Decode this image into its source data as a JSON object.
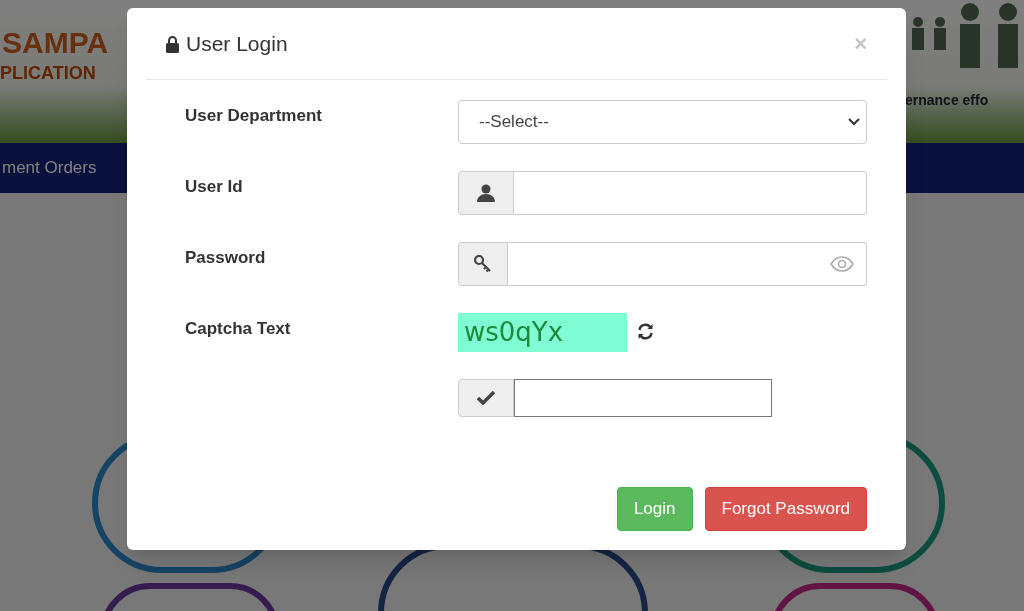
{
  "background": {
    "logo_text": "SAMPA",
    "logo_subtitle": "PLICATION",
    "tagline": "ernance effo",
    "nav_item": "ment Orders"
  },
  "modal": {
    "title": "User Login",
    "close": "×",
    "fields": [
      {
        "kind": "select",
        "label": "User Department",
        "value": "--Select--"
      },
      {
        "kind": "user",
        "label": "User Id"
      },
      {
        "kind": "password",
        "label": "Password"
      },
      {
        "kind": "captcha",
        "label": "Captcha Text",
        "captcha": "ws0qYx"
      },
      {
        "kind": "check"
      }
    ],
    "buttons": [
      {
        "kind": "success",
        "label": "Login"
      },
      {
        "kind": "danger",
        "label": "Forgot Password"
      }
    ]
  }
}
